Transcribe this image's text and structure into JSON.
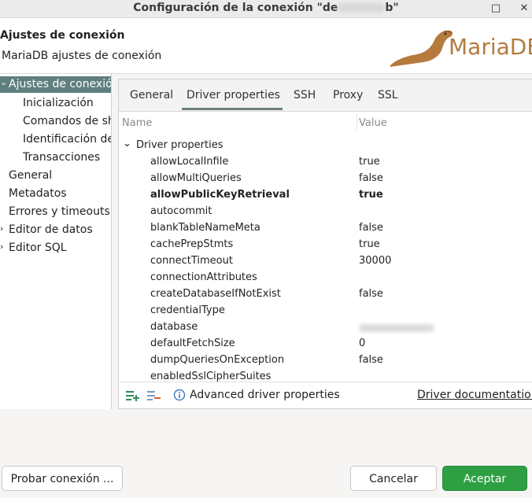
{
  "window": {
    "title_prefix": "Configuración de la conexión \"de",
    "title_suffix": "b\"",
    "minimize_glyph": "□",
    "close_glyph": "✕"
  },
  "header": {
    "title": "Ajustes de conexión",
    "subtitle": "MariaDB ajustes de conexión",
    "logo_text": "MariaDB"
  },
  "nav": {
    "items": [
      {
        "label": "Ajustes de conexión",
        "expanded": true,
        "selected": true
      },
      {
        "label": "Inicialización"
      },
      {
        "label": "Comandos de shell"
      },
      {
        "label": "Identificación de cliente"
      },
      {
        "label": "Transacciones"
      },
      {
        "label": "General"
      },
      {
        "label": "Metadatos"
      },
      {
        "label": "Errores y timeouts"
      },
      {
        "label": "Editor de datos"
      },
      {
        "label": "Editor SQL"
      }
    ]
  },
  "tabs": [
    "General",
    "Driver properties",
    "SSH",
    "Proxy",
    "SSL"
  ],
  "table": {
    "col_name": "Name",
    "col_value": "Value",
    "group": "Driver properties",
    "rows": [
      {
        "name": "allowLocalInfile",
        "value": "true"
      },
      {
        "name": "allowMultiQueries",
        "value": "false"
      },
      {
        "name": "allowPublicKeyRetrieval",
        "value": "true",
        "bold": true
      },
      {
        "name": "autocommit",
        "value": ""
      },
      {
        "name": "blankTableNameMeta",
        "value": "false"
      },
      {
        "name": "cachePrepStmts",
        "value": "true"
      },
      {
        "name": "connectTimeout",
        "value": "30000"
      },
      {
        "name": "connectionAttributes",
        "value": ""
      },
      {
        "name": "createDatabaseIfNotExist",
        "value": "false"
      },
      {
        "name": "credentialType",
        "value": ""
      },
      {
        "name": "database",
        "value": ""
      },
      {
        "name": "defaultFetchSize",
        "value": "0"
      },
      {
        "name": "dumpQueriesOnException",
        "value": "false"
      },
      {
        "name": "enabledSslCipherSuites",
        "value": ""
      }
    ]
  },
  "footer": {
    "advanced_label": "Advanced driver properties",
    "doc_link": "Driver documentation"
  },
  "buttons": {
    "test": "Probar conexión ...",
    "cancel": "Cancelar",
    "accept": "Aceptar"
  },
  "colors": {
    "selection": "#5f7f7e",
    "accept": "#2ea043",
    "add_icon": "#2e8b57",
    "remove_icon": "#d9603b",
    "info_icon": "#3b7bbf"
  }
}
